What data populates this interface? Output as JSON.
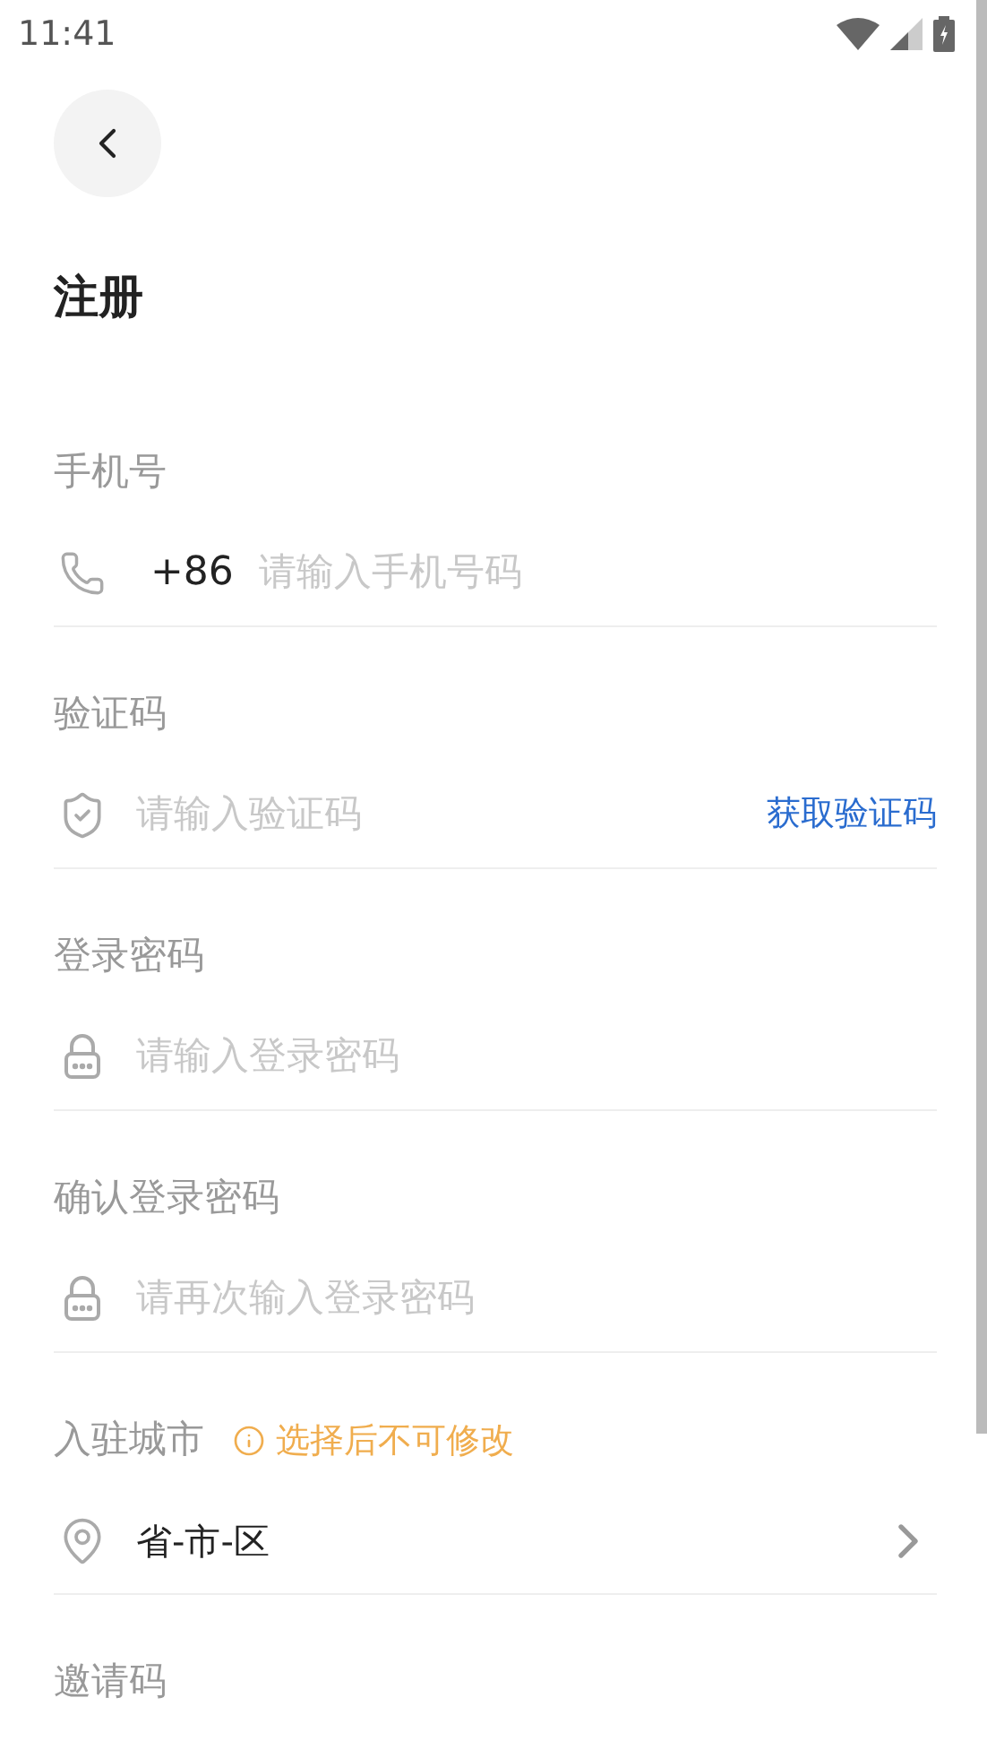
{
  "status_bar": {
    "time": "11:41"
  },
  "title": "注册",
  "fields": [
    {
      "label": "手机号",
      "kind": "phone",
      "prefix": "+86",
      "placeholder": "请输入手机号码"
    },
    {
      "label": "验证码",
      "kind": "code",
      "placeholder": "请输入验证码",
      "action": "获取验证码"
    },
    {
      "label": "登录密码",
      "kind": "password",
      "placeholder": "请输入登录密码"
    },
    {
      "label": "确认登录密码",
      "kind": "password",
      "placeholder": "请再次输入登录密码"
    },
    {
      "label": "入驻城市",
      "kind": "city",
      "note": "选择后不可修改",
      "value": "省-市-区"
    },
    {
      "label": "邀请码",
      "kind": "invite"
    }
  ]
}
